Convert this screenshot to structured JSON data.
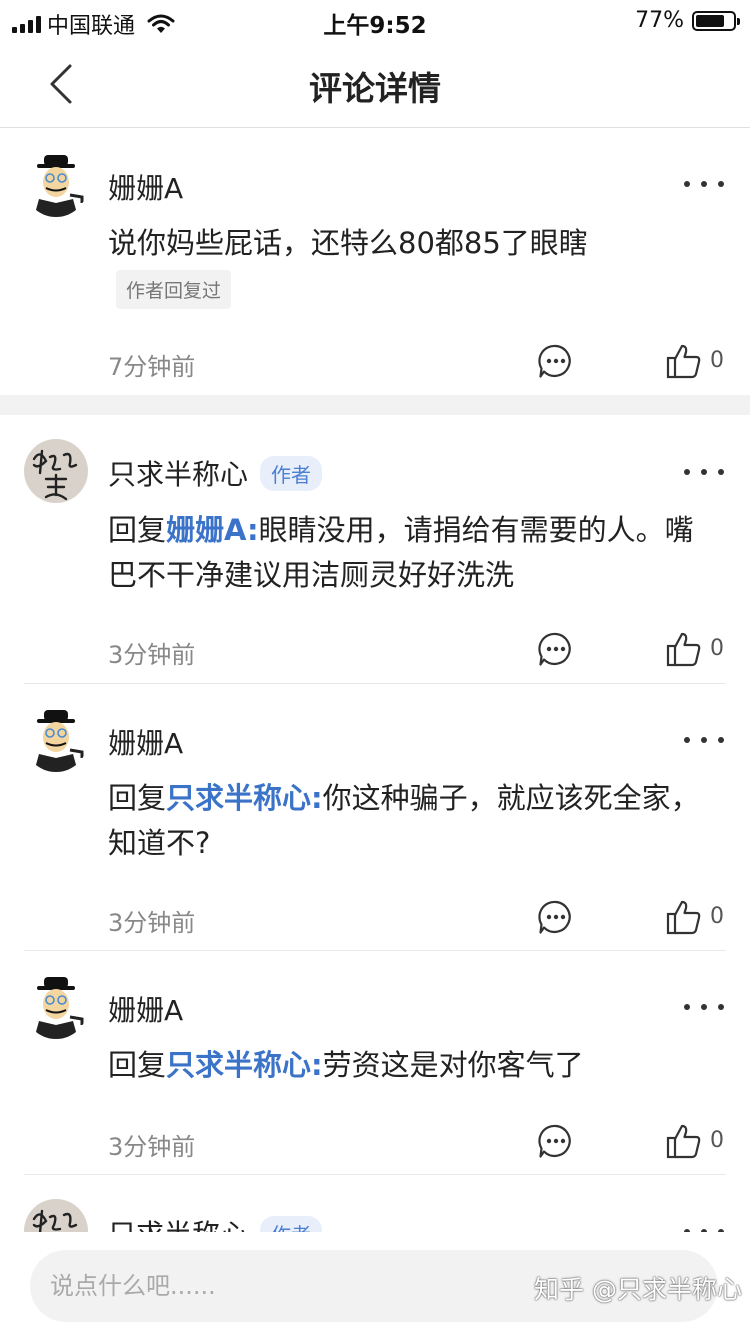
{
  "status_bar": {
    "carrier": "中国联通",
    "time": "上午9:52",
    "battery": "77%",
    "battery_level": 0.77,
    "icons": [
      "signal-icon",
      "wifi-icon",
      "battery-icon"
    ]
  },
  "nav": {
    "title": "评论详情",
    "back_icon": "back-chevron-icon"
  },
  "comments": [
    {
      "username": "姗姗A",
      "content": "说你妈些屁话，还特么80都85了眼瞎",
      "tag": "作者回复过",
      "time": "7分钟前",
      "likes": "0"
    },
    {
      "username": "只求半称心",
      "badge": "作者",
      "reply_prefix": "回复",
      "reply_to": "姗姗A:",
      "content": "眼睛没用，请捐给有需要的人。嘴巴不干净建议用洁厕灵好好洗洗",
      "time": "3分钟前",
      "likes": "0"
    },
    {
      "username": "姗姗A",
      "reply_prefix": "回复",
      "reply_to": "只求半称心:",
      "content": "你这种骗子，就应该死全家，知道不?",
      "time": "3分钟前",
      "likes": "0"
    },
    {
      "username": "姗姗A",
      "reply_prefix": "回复",
      "reply_to": "只求半称心:",
      "content": "劳资这是对你客气了",
      "time": "3分钟前",
      "likes": "0"
    },
    {
      "username": "只求半称心",
      "badge": "作者"
    }
  ],
  "input": {
    "placeholder": "说点什么吧......"
  },
  "watermark": "知乎 @只求半称心",
  "colors": {
    "link_blue": "#3b73c8",
    "badge_bg": "#e8eefa",
    "divider": "#e8e8e8"
  }
}
